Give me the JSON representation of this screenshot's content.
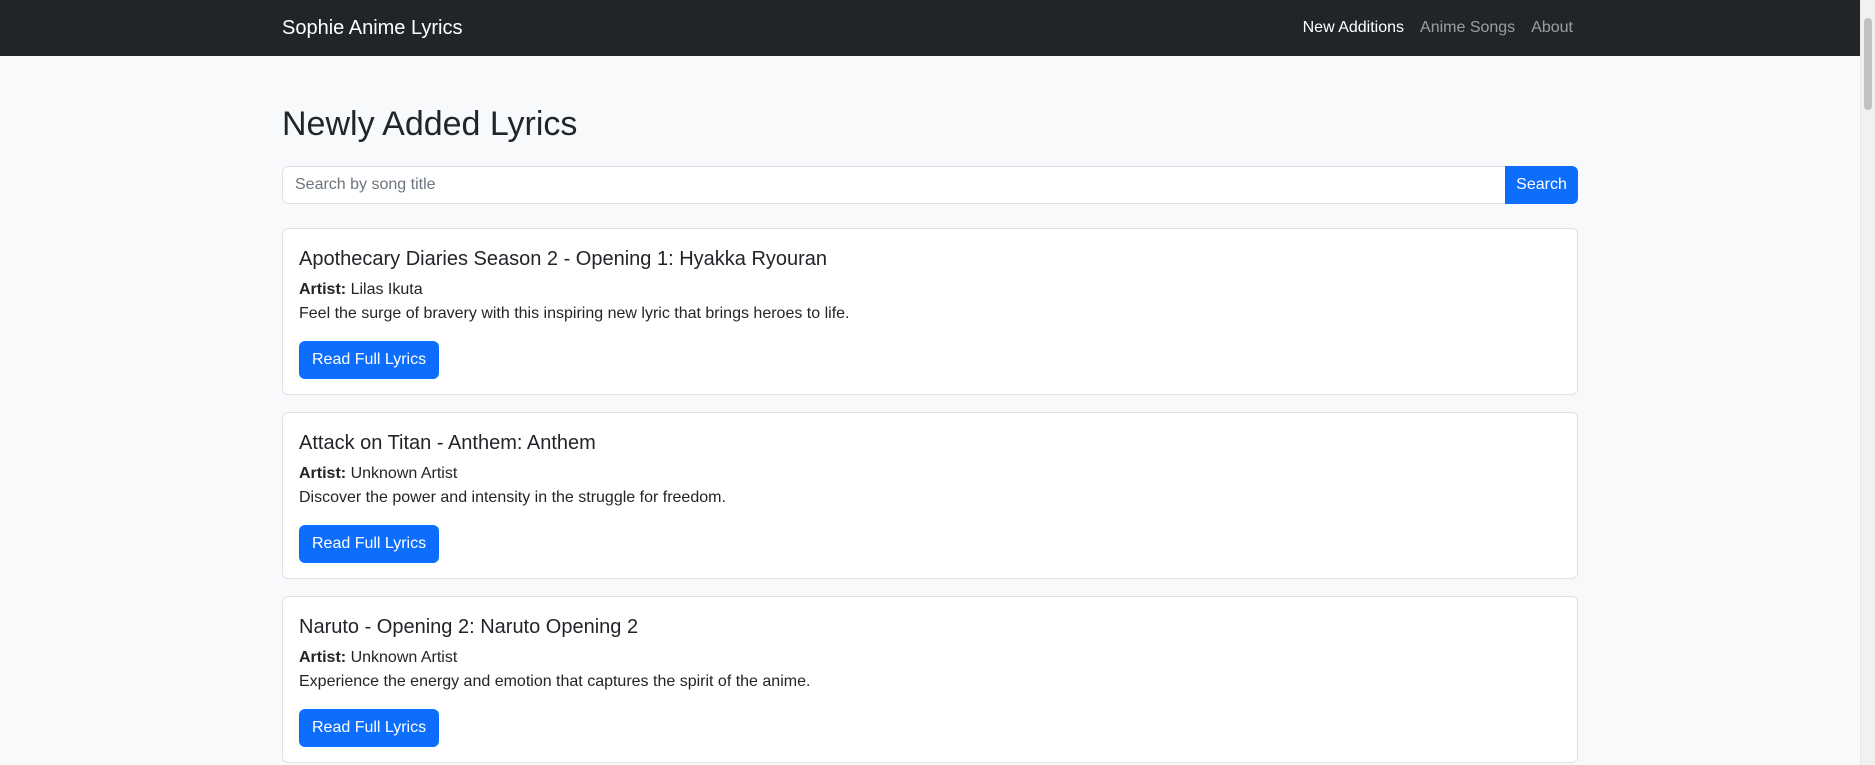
{
  "navbar": {
    "brand": "Sophie Anime Lyrics",
    "links": [
      {
        "label": "New Additions",
        "active": true
      },
      {
        "label": "Anime Songs",
        "active": false
      },
      {
        "label": "About",
        "active": false
      }
    ]
  },
  "main": {
    "title": "Newly Added Lyrics",
    "search": {
      "placeholder": "Search by song title",
      "value": "",
      "button_label": "Search"
    },
    "artist_label": "Artist:",
    "cards": [
      {
        "title": "Apothecary Diaries Season 2 - Opening 1: Hyakka Ryouran",
        "artist": "Lilas Ikuta",
        "description": "Feel the surge of bravery with this inspiring new lyric that brings heroes to life.",
        "button_label": "Read Full Lyrics"
      },
      {
        "title": "Attack on Titan - Anthem: Anthem",
        "artist": "Unknown Artist",
        "description": "Discover the power and intensity in the struggle for freedom.",
        "button_label": "Read Full Lyrics"
      },
      {
        "title": "Naruto - Opening 2: Naruto Opening 2",
        "artist": "Unknown Artist",
        "description": "Experience the energy and emotion that captures the spirit of the anime.",
        "button_label": "Read Full Lyrics"
      }
    ]
  },
  "colors": {
    "navbar_bg": "#212529",
    "page_bg": "#f8f9fa",
    "primary": "#0d6efd"
  }
}
